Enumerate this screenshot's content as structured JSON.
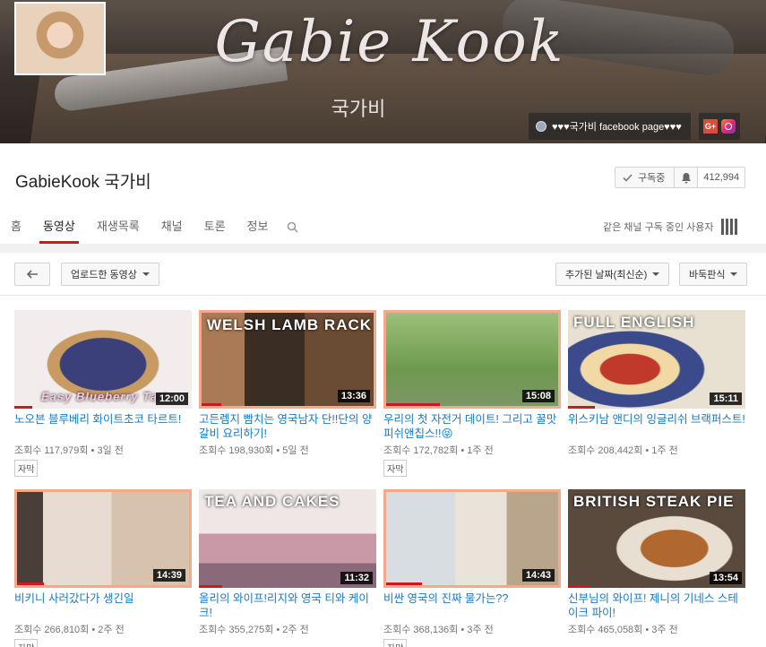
{
  "banner": {
    "title": "Gabie Kook",
    "subtitle": "국가비",
    "facebook_link": "♥♥♥국가비 facebook page♥♥♥"
  },
  "channel": {
    "name": "GabieKook 국가비",
    "subscribe_label": "구독중",
    "subscriber_count": "412,994",
    "related_channels": "같은 채널 구독 중인 사용자"
  },
  "tabs": [
    {
      "label": "홈"
    },
    {
      "label": "동영상"
    },
    {
      "label": "재생목록"
    },
    {
      "label": "채널"
    },
    {
      "label": "토론"
    },
    {
      "label": "정보"
    }
  ],
  "toolbar": {
    "uploads_label": "업로드한 동영상",
    "sort_label": "추가된 날짜(최신순)",
    "view_label": "바둑판식"
  },
  "videos": [
    {
      "title": "노오븐 블루베리 화이트초코 타르트!",
      "views": "조회수 117,979회",
      "age": "3일 전",
      "duration": "12:00",
      "badge": "자막",
      "overlay": "Easy Blueberry Tart"
    },
    {
      "title": "고든렘지 빰치는 영국남자 단!!단의 양갈비 요리하기!",
      "views": "조회수 198,930회",
      "age": "5일 전",
      "duration": "13:36",
      "badge": "",
      "overlay": "WELSH LAMB RACK"
    },
    {
      "title": "우리의 첫 자전거 데이트! 그리고 꿀맛 피쉬앤칩스!!😝",
      "views": "조회수 172,782회",
      "age": "1주 전",
      "duration": "15:08",
      "badge": "자막",
      "overlay": ""
    },
    {
      "title": "위스키남 앤디의 잉글리쉬 브랙퍼스트!",
      "views": "조회수 208,442회",
      "age": "1주 전",
      "duration": "15:11",
      "badge": "",
      "overlay": "FULL ENGLISH"
    },
    {
      "title": "비키니 사러갔다가 생긴일",
      "views": "조회수 266,810회",
      "age": "2주 전",
      "duration": "14:39",
      "badge": "자막",
      "overlay": ""
    },
    {
      "title": "올리의 와이프!리지와 영국 티와 케이크!",
      "views": "조회수 355,275회",
      "age": "2주 전",
      "duration": "11:32",
      "badge": "",
      "overlay": "TEA AND CAKES"
    },
    {
      "title": "비싼 영국의 진짜 물가는??",
      "views": "조회수 368,136회",
      "age": "3주 전",
      "duration": "14:43",
      "badge": "자막",
      "overlay": ""
    },
    {
      "title": "신부님의 와이프! 제니의 기네스 스테이크 파이!",
      "views": "조회수 465,058회",
      "age": "3주 전",
      "duration": "13:54",
      "badge": "",
      "overlay": "BRITISH STEAK PIE"
    }
  ]
}
